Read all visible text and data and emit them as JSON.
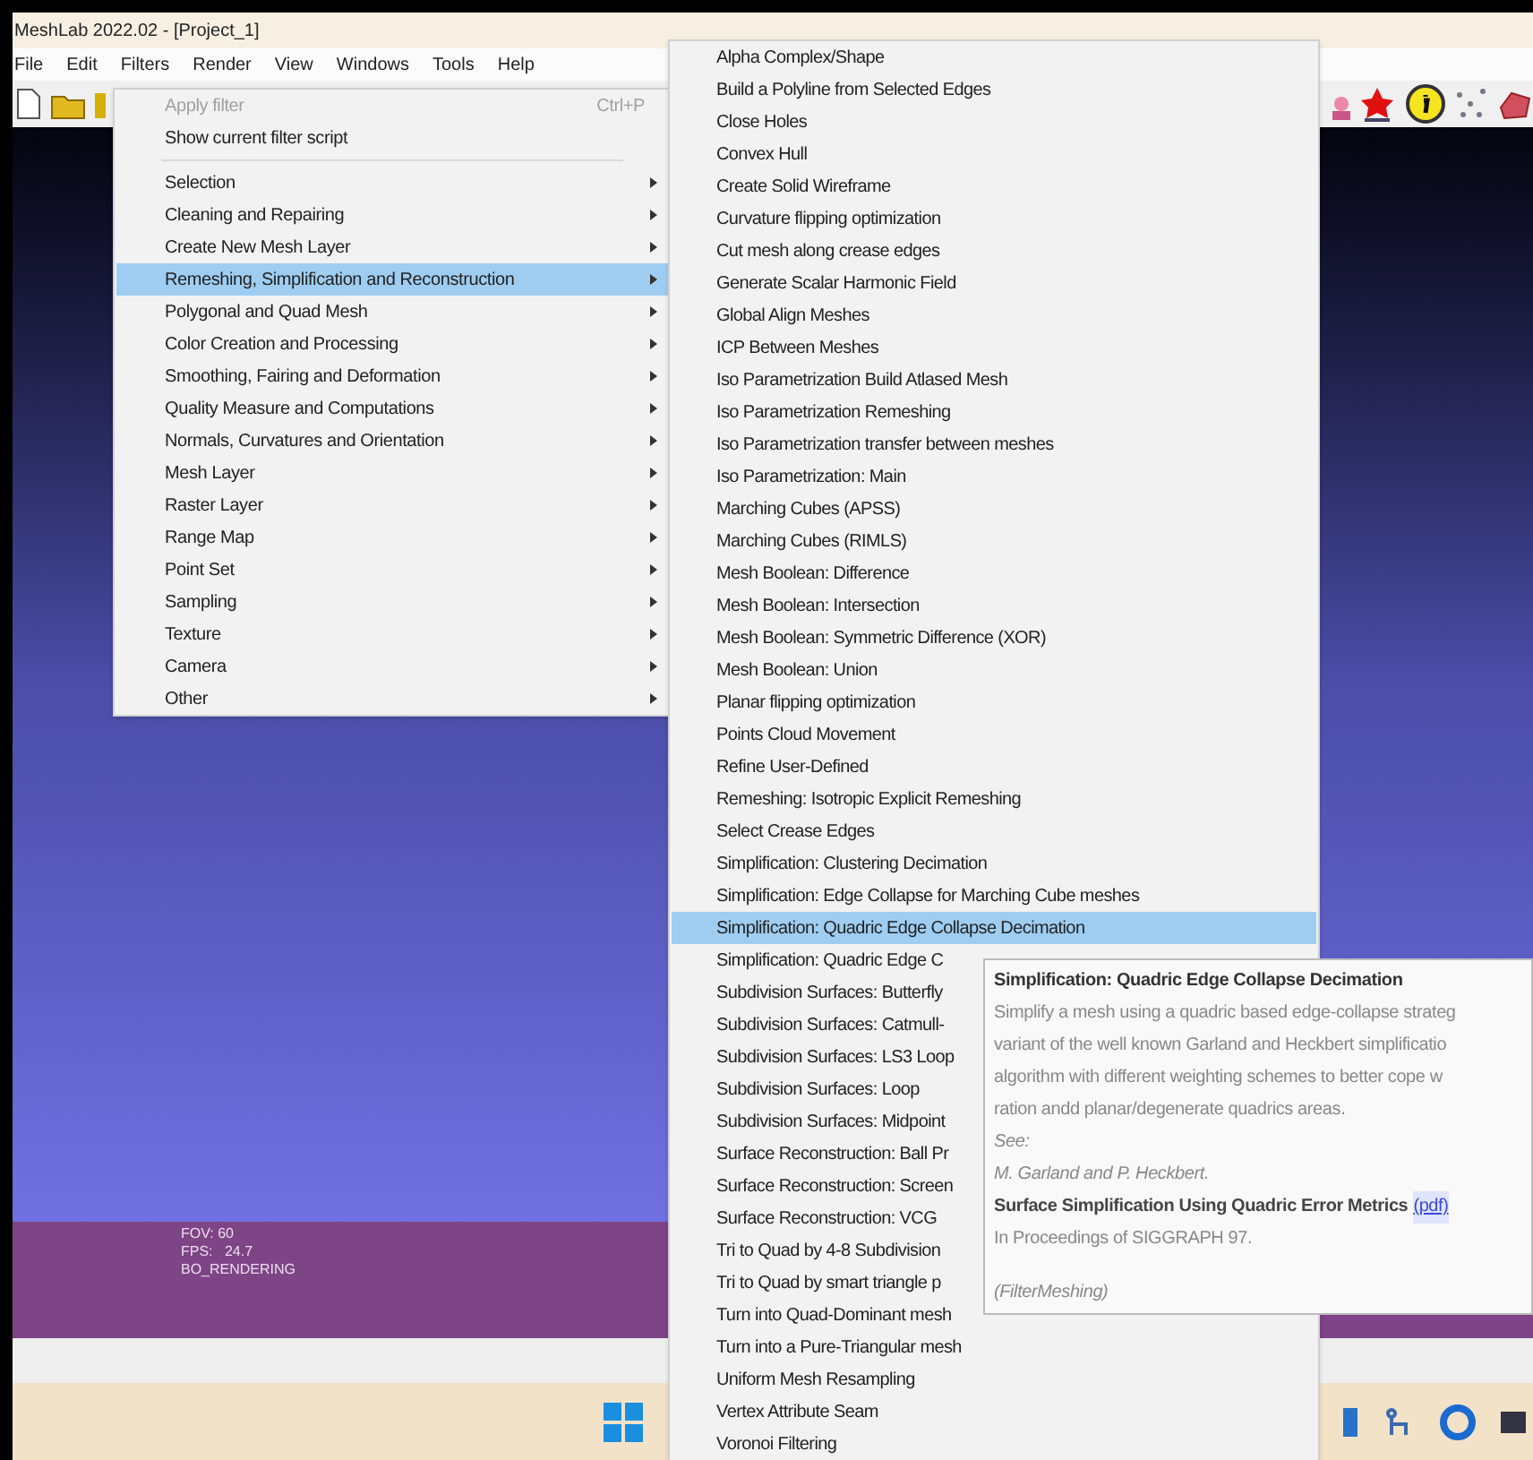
{
  "window": {
    "title": "MeshLab 2022.02 - [Project_1]"
  },
  "menubar": [
    "File",
    "Edit",
    "Filters",
    "Render",
    "View",
    "Windows",
    "Tools",
    "Help"
  ],
  "filters_menu": {
    "items": [
      {
        "kind": "action",
        "label": "Apply filter",
        "shortcut": "Ctrl+P",
        "disabled": true
      },
      {
        "kind": "action",
        "label": "Show current filter script",
        "disabled": false
      },
      {
        "kind": "separator"
      },
      {
        "kind": "submenu",
        "label": "Selection",
        "selected": false
      },
      {
        "kind": "submenu",
        "label": "Cleaning and Repairing",
        "selected": false
      },
      {
        "kind": "submenu",
        "label": "Create New Mesh Layer",
        "selected": false
      },
      {
        "kind": "submenu",
        "label": "Remeshing, Simplification and Reconstruction",
        "selected": true
      },
      {
        "kind": "submenu",
        "label": "Polygonal and Quad Mesh",
        "selected": false
      },
      {
        "kind": "submenu",
        "label": "Color Creation and Processing",
        "selected": false
      },
      {
        "kind": "submenu",
        "label": "Smoothing, Fairing and Deformation",
        "selected": false
      },
      {
        "kind": "submenu",
        "label": "Quality Measure and Computations",
        "selected": false
      },
      {
        "kind": "submenu",
        "label": "Normals, Curvatures and Orientation",
        "selected": false
      },
      {
        "kind": "submenu",
        "label": "Mesh Layer",
        "selected": false
      },
      {
        "kind": "submenu",
        "label": "Raster Layer",
        "selected": false
      },
      {
        "kind": "submenu",
        "label": "Range Map",
        "selected": false
      },
      {
        "kind": "submenu",
        "label": "Point Set",
        "selected": false
      },
      {
        "kind": "submenu",
        "label": "Sampling",
        "selected": false
      },
      {
        "kind": "submenu",
        "label": "Texture",
        "selected": false
      },
      {
        "kind": "submenu",
        "label": "Camera",
        "selected": false
      },
      {
        "kind": "submenu",
        "label": "Other",
        "selected": false
      }
    ]
  },
  "submenu": {
    "items": [
      {
        "label": "Alpha Complex/Shape",
        "selected": false
      },
      {
        "label": "Build a Polyline from Selected Edges",
        "selected": false
      },
      {
        "label": "Close Holes",
        "selected": false
      },
      {
        "label": "Convex Hull",
        "selected": false
      },
      {
        "label": "Create Solid Wireframe",
        "selected": false
      },
      {
        "label": "Curvature flipping optimization",
        "selected": false
      },
      {
        "label": "Cut mesh along crease edges",
        "selected": false
      },
      {
        "label": "Generate Scalar Harmonic Field",
        "selected": false
      },
      {
        "label": "Global Align Meshes",
        "selected": false
      },
      {
        "label": "ICP Between Meshes",
        "selected": false
      },
      {
        "label": "Iso Parametrization Build Atlased Mesh",
        "selected": false
      },
      {
        "label": "Iso Parametrization Remeshing",
        "selected": false
      },
      {
        "label": "Iso Parametrization transfer between meshes",
        "selected": false
      },
      {
        "label": "Iso Parametrization: Main",
        "selected": false
      },
      {
        "label": "Marching Cubes (APSS)",
        "selected": false
      },
      {
        "label": "Marching Cubes (RIMLS)",
        "selected": false
      },
      {
        "label": "Mesh Boolean: Difference",
        "selected": false
      },
      {
        "label": "Mesh Boolean: Intersection",
        "selected": false
      },
      {
        "label": "Mesh Boolean: Symmetric Difference (XOR)",
        "selected": false
      },
      {
        "label": "Mesh Boolean: Union",
        "selected": false
      },
      {
        "label": "Planar flipping optimization",
        "selected": false
      },
      {
        "label": "Points Cloud Movement",
        "selected": false
      },
      {
        "label": "Refine User-Defined",
        "selected": false
      },
      {
        "label": "Remeshing: Isotropic Explicit Remeshing",
        "selected": false
      },
      {
        "label": "Select Crease Edges",
        "selected": false
      },
      {
        "label": "Simplification: Clustering Decimation",
        "selected": false
      },
      {
        "label": "Simplification: Edge Collapse for Marching Cube meshes",
        "selected": false
      },
      {
        "label": "Simplification: Quadric Edge Collapse Decimation",
        "selected": true
      },
      {
        "label": "Simplification: Quadric Edge C",
        "selected": false
      },
      {
        "label": "Subdivision Surfaces: Butterfly",
        "selected": false
      },
      {
        "label": "Subdivision Surfaces: Catmull-",
        "selected": false
      },
      {
        "label": "Subdivision Surfaces: LS3 Loop",
        "selected": false
      },
      {
        "label": "Subdivision Surfaces: Loop",
        "selected": false
      },
      {
        "label": "Subdivision Surfaces: Midpoint",
        "selected": false
      },
      {
        "label": "Surface Reconstruction: Ball Pr",
        "selected": false
      },
      {
        "label": "Surface Reconstruction: Screen",
        "selected": false
      },
      {
        "label": "Surface Reconstruction: VCG",
        "selected": false
      },
      {
        "label": "Tri to Quad by 4-8 Subdivision",
        "selected": false
      },
      {
        "label": "Tri to Quad by smart triangle p",
        "selected": false
      },
      {
        "label": "Turn into Quad-Dominant mesh",
        "selected": false
      },
      {
        "label": "Turn into a Pure-Triangular mesh",
        "selected": false
      },
      {
        "label": "Uniform Mesh Resampling",
        "selected": false
      },
      {
        "label": "Vertex Attribute Seam",
        "selected": false
      },
      {
        "label": "Voronoi Filtering",
        "selected": false
      }
    ]
  },
  "tooltip": {
    "title": "Simplification: Quadric Edge Collapse Decimation",
    "description": [
      "Simplify a mesh using a quadric based edge-collapse strateg",
      "variant of the well known Garland and Heckbert simplificatio",
      "algorithm with different weighting schemes to better cope w",
      "ration andd planar/degenerate quadrics areas."
    ],
    "see": "See:",
    "authors": "M. Garland and P. Heckbert.",
    "paper": "Surface Simplification Using Quadric Error Metrics",
    "link": "(pdf)",
    "venue": "In Proceedings of SIGGRAPH 97.",
    "category": "(FilterMeshing)"
  },
  "viewport": {
    "info": [
      "FOV: 60",
      "FPS:   24.7",
      "BO_RENDERING"
    ]
  }
}
